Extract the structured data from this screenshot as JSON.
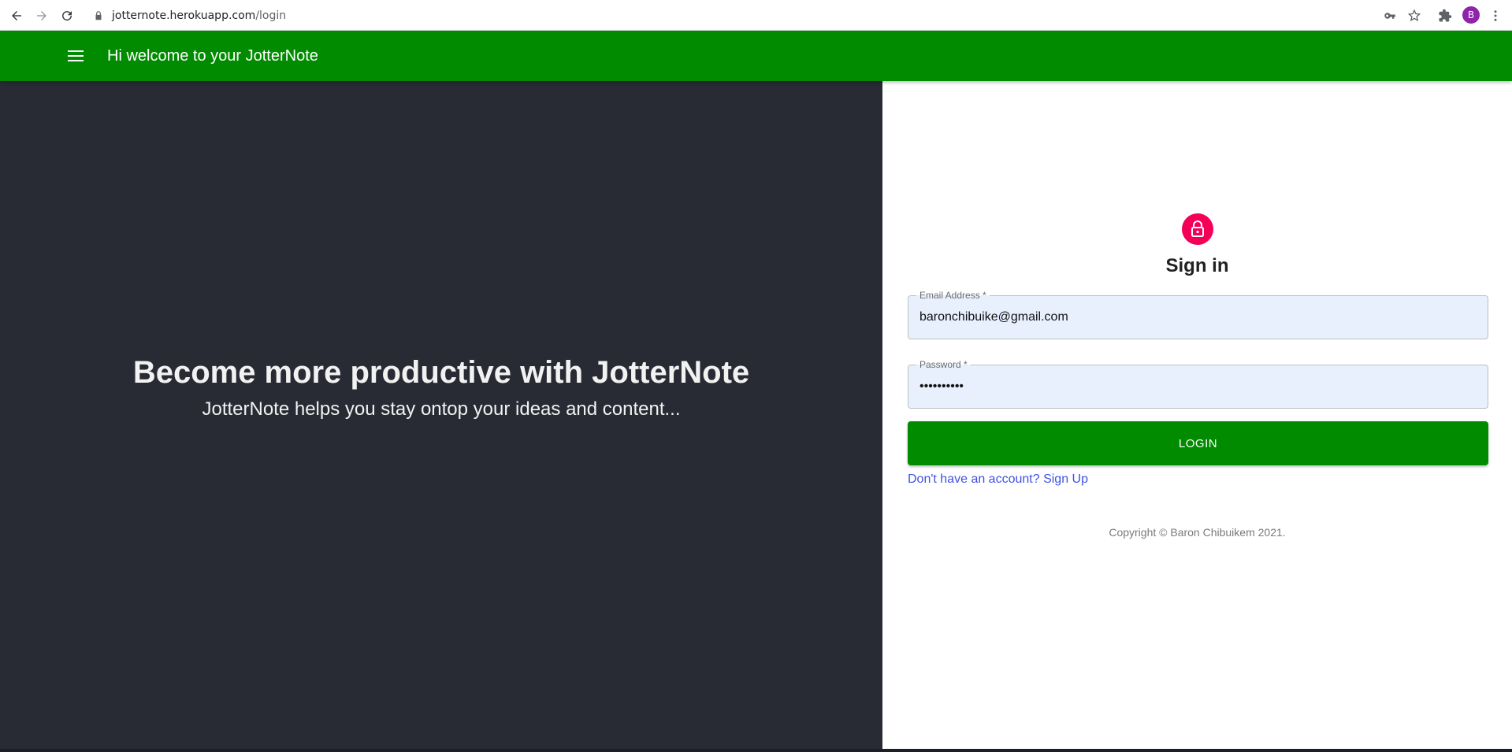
{
  "browser": {
    "url_host": "jotternote.herokuapp.com",
    "url_path": "/login",
    "profile_initial": "B"
  },
  "app_bar": {
    "title": "Hi welcome to your JotterNote"
  },
  "hero": {
    "title": "Become more productive with JotterNote",
    "subtitle": "JotterNote helps you stay ontop your ideas and content..."
  },
  "login": {
    "heading": "Sign in",
    "email_label": "Email Address *",
    "email_value": "baronchibuike@gmail.com",
    "password_label": "Password *",
    "password_value": "••••••••••",
    "submit_label": "LOGIN",
    "signup_link": "Don't have an account? Sign Up",
    "copyright": "Copyright © Baron Chibuikem 2021."
  },
  "colors": {
    "brand_green": "#008b00",
    "hero_bg": "#282b34",
    "lock_avatar": "#f50057",
    "link_blue": "#3f51e3"
  },
  "icons": {
    "back": "back-arrow-icon",
    "forward": "forward-arrow-icon",
    "reload": "reload-icon",
    "lock": "lock-icon",
    "key": "key-icon",
    "star": "star-icon",
    "extensions": "puzzle-icon",
    "menu": "more-vert-icon",
    "hamburger": "hamburger-menu-icon",
    "padlock": "padlock-icon"
  }
}
